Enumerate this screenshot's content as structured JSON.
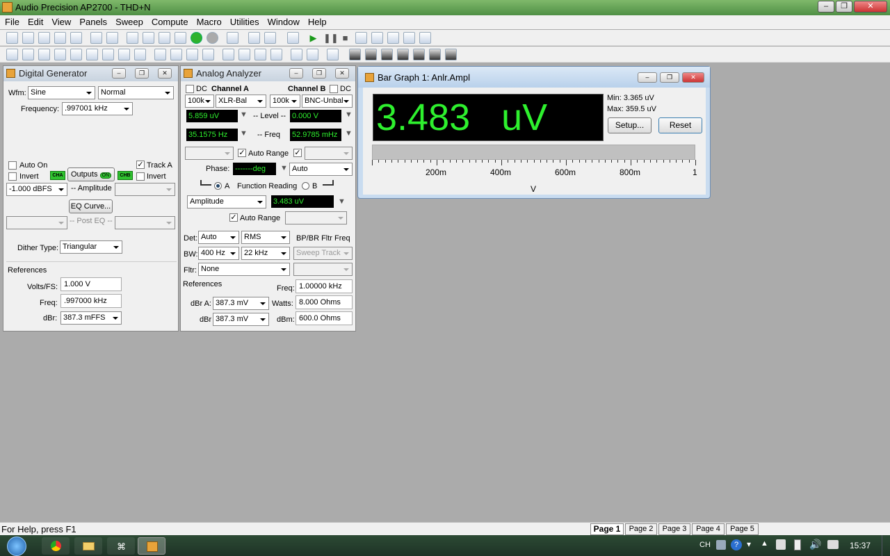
{
  "app": {
    "title": "Audio Precision AP2700 - THD+N"
  },
  "menu": [
    "File",
    "Edit",
    "View",
    "Panels",
    "Sweep",
    "Compute",
    "Macro",
    "Utilities",
    "Window",
    "Help"
  ],
  "digital_generator": {
    "title": "Digital Generator",
    "wfm_label": "Wfm:",
    "wfm_value": "Sine",
    "wfm_mode": "Normal",
    "frequency_label": "Frequency:",
    "frequency_value": ".997001 kHz",
    "auto_on_label": "Auto On",
    "invert_label": "Invert",
    "track_a_label": "Track A",
    "invert_b_label": "Invert",
    "outputs_label": "Outputs",
    "on_badge": "ON",
    "cha_badge": "CHA",
    "chb_badge": "CHB",
    "amplitude_value": "-1.000  dBFS",
    "amplitude_label": "-- Amplitude",
    "eq_curve_label": "EQ Curve...",
    "post_eq_label": "-- Post EQ --",
    "dither_label": "Dither Type:",
    "dither_value": "Triangular",
    "references_label": "References",
    "volts_fs_label": "Volts/FS:",
    "volts_fs_value": "1.000    V",
    "freq_label": "Freq:",
    "freq_value": ".997000 kHz",
    "dbr_label": "dBr:",
    "dbr_value": "387.3   mFFS"
  },
  "analog_analyzer": {
    "title": "Analog Analyzer",
    "dc_label": "DC",
    "channel_a_label": "Channel A",
    "channel_b_label": "Channel B",
    "dc_b_label": "DC",
    "cha_range": "100k",
    "cha_input": "XLR-Bal",
    "chb_range": "100k",
    "chb_input": "BNC-Unbal",
    "level_a": "5.859   uV",
    "level_label": "-- Level --",
    "level_b": "0.000    V",
    "freq_a": "35.1575  Hz",
    "freq_label": "-- Freq",
    "freq_b": "52.9785 mHz",
    "auto_range_label": "Auto Range",
    "phase_label": "Phase:",
    "phase_value": "-------deg",
    "phase_mode": "Auto",
    "radio_a_label": "A",
    "function_reading_label": "Function Reading",
    "radio_b_label": "B",
    "function_value": "Amplitude",
    "function_reading": "3.483   uV",
    "auto_range2_label": "Auto Range",
    "det_label": "Det:",
    "det_value": "Auto",
    "det_mode": "RMS",
    "bp_label": "BP/BR Fltr Freq",
    "bw_label": "BW:",
    "bw_low": "400 Hz",
    "bw_high": "22 kHz",
    "sweep_track": "Sweep Track",
    "fltr_label": "Fltr:",
    "fltr_value": "None",
    "references_label": "References",
    "ref_freq_label": "Freq:",
    "ref_freq_value": "1.00000 kHz",
    "dbra_label": "dBr A:",
    "dbra_value": "387.3   mV",
    "watts_label": "Watts:",
    "watts_value": "8.000    Ohms",
    "dbr_label": "dBr",
    "dbr_value": "387.3   mV",
    "dbm_label": "dBm:",
    "dbm_value": "600.0    Ohms"
  },
  "bar_graph": {
    "title": "Bar Graph 1: Anlr.Ampl",
    "reading": "3.483   uV",
    "min_label": "Min: 3.365   uV",
    "max_label": "Max: 359.5   uV",
    "setup_label": "Setup...",
    "reset_label": "Reset",
    "bar_fraction": 0.0,
    "scale_labels": [
      "200m",
      "400m",
      "600m",
      "800m",
      "1"
    ],
    "unit_label": "V"
  },
  "status": {
    "help_text": "For Help, press F1",
    "pages": [
      "Page 1",
      "Page 2",
      "Page 3",
      "Page 4",
      "Page 5"
    ]
  },
  "taskbar": {
    "lang": "CH",
    "clock": "15:37"
  }
}
